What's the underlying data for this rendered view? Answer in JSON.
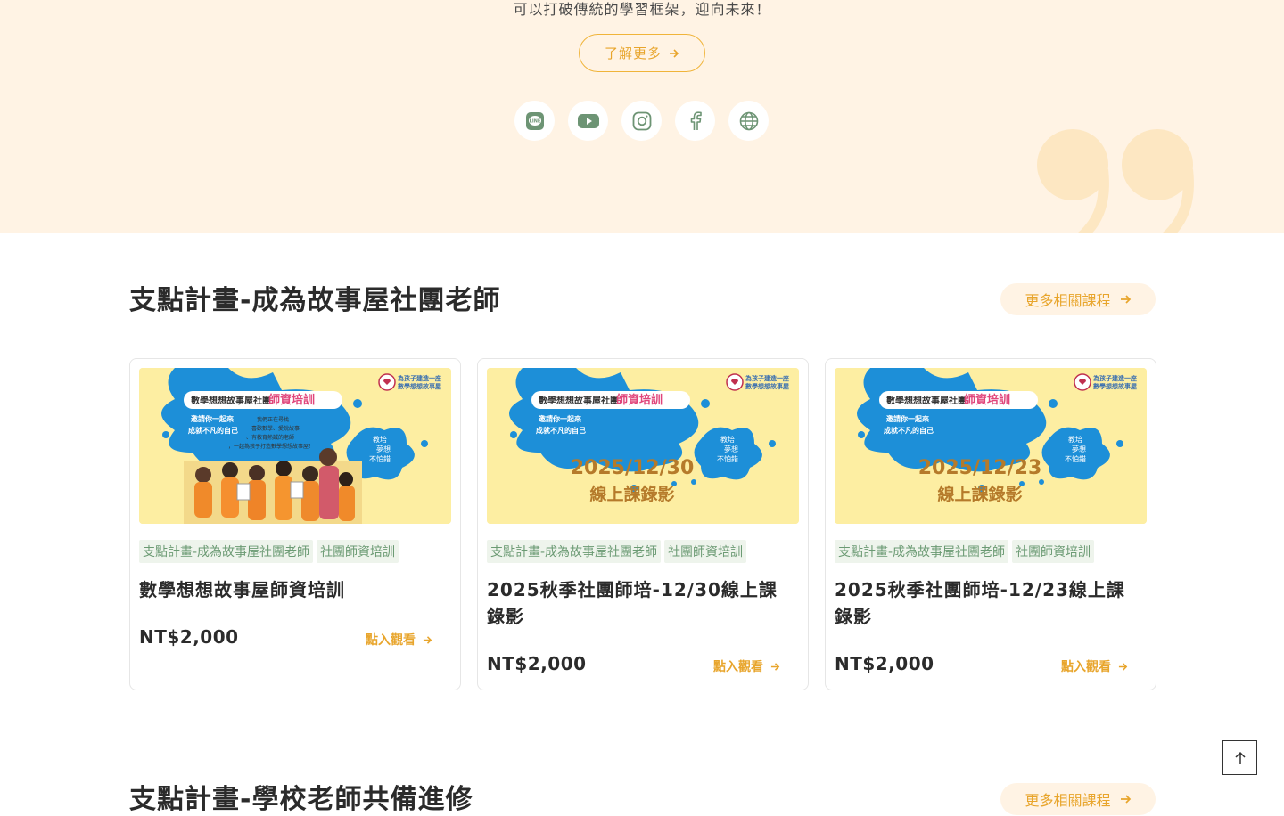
{
  "hero": {
    "text": "可以打破傳統的學習框架，迎向未來！",
    "learn_more": "了解更多"
  },
  "social": [
    "line-icon",
    "youtube-icon",
    "instagram-icon",
    "facebook-icon",
    "globe-icon"
  ],
  "section1": {
    "title": "支點計畫-成為故事屋社團老師",
    "more": "更多相關課程"
  },
  "cards": [
    {
      "banner_brand": "數學想想故事屋社團",
      "banner_label": "師資培訓",
      "banner_tagline": "為孩子建造一座數學想想故事屋",
      "banner_invite": "邀請你一起來 成就不凡的自己",
      "banner_desc": "我們正在尋找 喜歡數學、愛說故事、有教育熱誠的老師，一起為孩子打造數學想想故事屋！",
      "banner_splash": "教培 夢想 不怕錯",
      "banner_date": "",
      "banner_sub": "",
      "tags": [
        "支點計畫-成為故事屋社團老師",
        "社團師資培訓"
      ],
      "title": "數學想想故事屋師資培訓",
      "price": "NT$2,000",
      "watch": "點入觀看"
    },
    {
      "banner_brand": "數學想想故事屋社團",
      "banner_label": "師資培訓",
      "banner_tagline": "為孩子建造一座數學想想故事屋",
      "banner_invite": "邀請你一起來 成就不凡的自己",
      "banner_desc": "",
      "banner_splash": "教培 夢想 不怕錯",
      "banner_date": "2025/12/30",
      "banner_sub": "線上課錄影",
      "tags": [
        "支點計畫-成為故事屋社團老師",
        "社團師資培訓"
      ],
      "title": "2025秋季社團師培-12/30線上課錄影",
      "price": "NT$2,000",
      "watch": "點入觀看"
    },
    {
      "banner_brand": "數學想想故事屋社團",
      "banner_label": "師資培訓",
      "banner_tagline": "為孩子建造一座數學想想故事屋",
      "banner_invite": "邀請你一起來 成就不凡的自己",
      "banner_desc": "",
      "banner_splash": "教培 夢想 不怕錯",
      "banner_date": "2025/12/23",
      "banner_sub": "線上課錄影",
      "tags": [
        "支點計畫-成為故事屋社團老師",
        "社團師資培訓"
      ],
      "title": "2025秋季社團師培-12/23線上課錄影",
      "price": "NT$2,000",
      "watch": "點入觀看"
    }
  ],
  "section2": {
    "title": "支點計畫-學校老師共備進修",
    "more": "更多相關課程"
  },
  "colors": {
    "accent": "#e8a52c",
    "hero_bg": "#fff3e4",
    "tag_bg": "#eef4ec",
    "tag_text": "#6b9a73",
    "banner_bg": "#fdeea2",
    "splash": "#1d8fd8"
  }
}
